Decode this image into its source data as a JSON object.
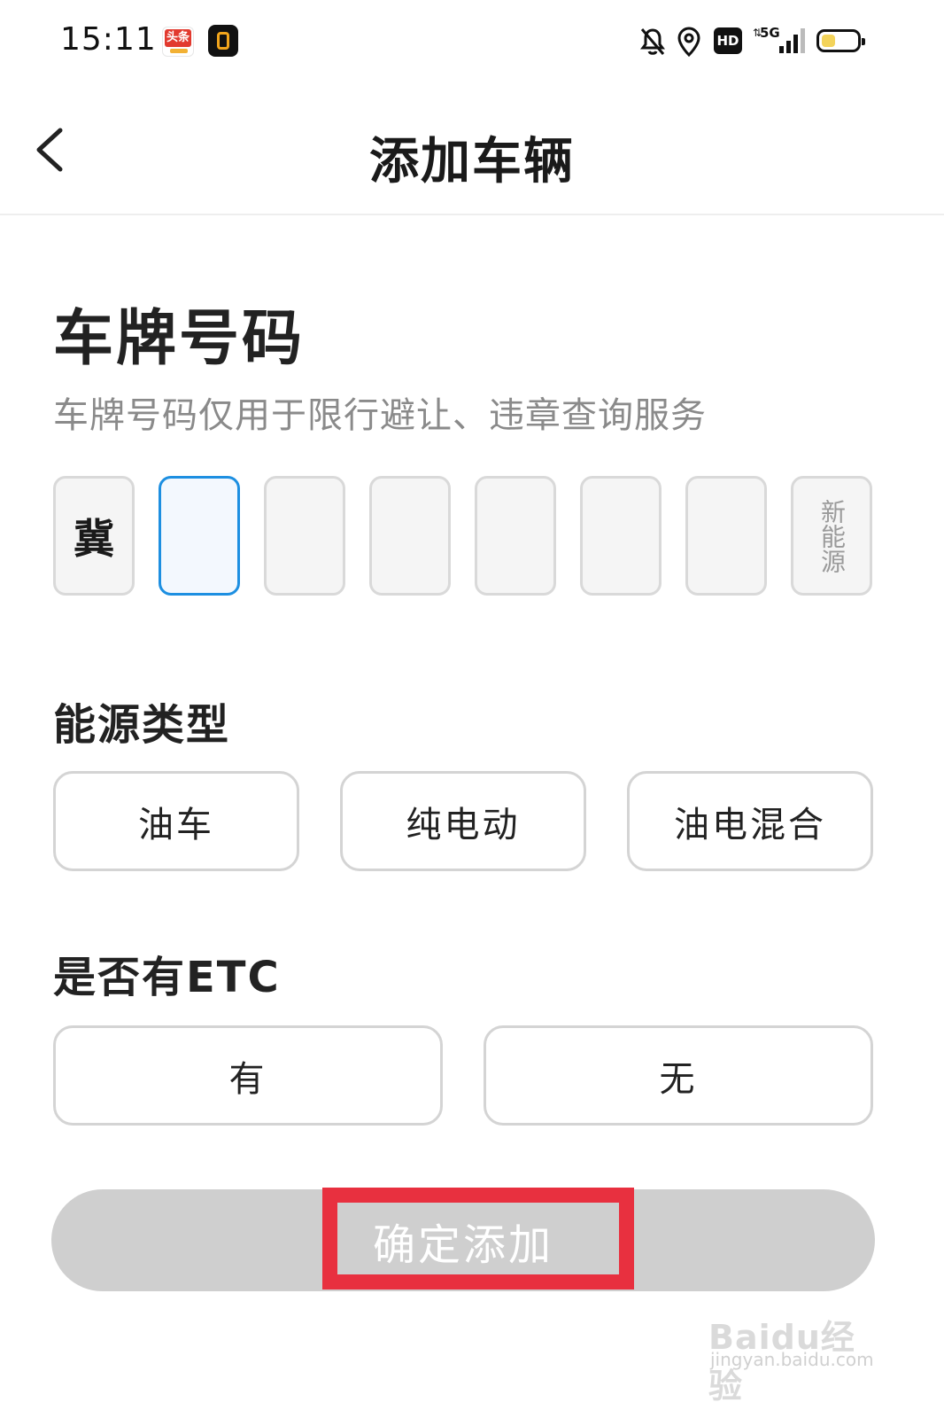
{
  "status_bar": {
    "time": "15:11",
    "toutiao_badge": "头条",
    "network": "5G",
    "hd_label": "HD",
    "icons": [
      "toutiao-app-icon",
      "black-app-icon",
      "bell-off-icon",
      "location-icon",
      "hd-icon",
      "signal-icon",
      "battery-icon"
    ]
  },
  "header": {
    "title": "添加车辆",
    "back_icon": "chevron-left-icon"
  },
  "plate": {
    "title": "车牌号码",
    "description": "车牌号码仅用于限行避让、违章查询服务",
    "province": "冀",
    "cells": [
      "",
      "",
      "",
      "",
      "",
      ""
    ],
    "new_energy_label": "新能源",
    "active_color": "#1d8fe1"
  },
  "energy": {
    "title": "能源类型",
    "options": [
      "油车",
      "纯电动",
      "油电混合"
    ]
  },
  "etc": {
    "title": "是否有ETC",
    "options": [
      "有",
      "无"
    ]
  },
  "confirm": {
    "label": "确定添加",
    "highlight_color": "#e8303f"
  },
  "watermark": {
    "brand": "Baidu经验",
    "url": "jingyan.baidu.com"
  }
}
